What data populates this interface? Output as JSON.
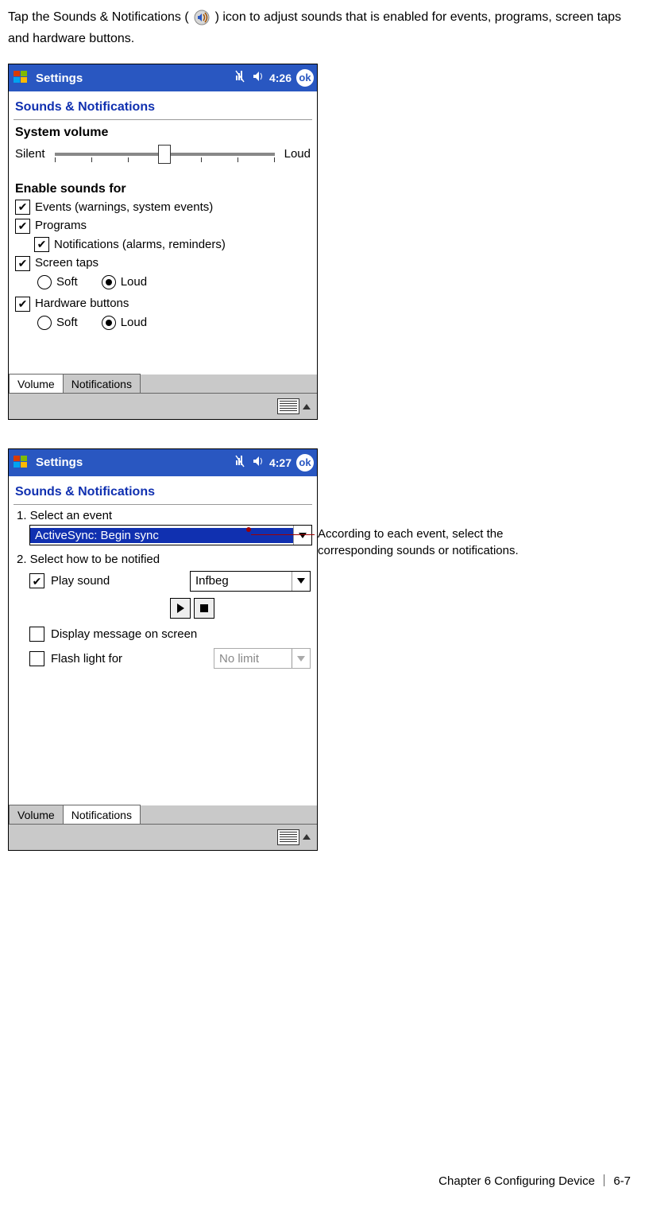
{
  "intro_before": "Tap the Sounds & Notifications (",
  "intro_after": ") icon to adjust sounds that is enabled for events, programs, screen taps and hardware buttons.",
  "screen1": {
    "title": "Settings",
    "time": "4:26",
    "ok": "ok",
    "panel": "Sounds & Notifications",
    "sysvol": "System volume",
    "silent": "Silent",
    "loud": "Loud",
    "enable": "Enable sounds for",
    "events": "Events (warnings, system events)",
    "programs": "Programs",
    "notifications": "Notifications (alarms, reminders)",
    "screentaps": "Screen taps",
    "soft1": "Soft",
    "loud1": "Loud",
    "hwbtn": "Hardware buttons",
    "soft2": "Soft",
    "loud2": "Loud",
    "tab_volume": "Volume",
    "tab_notif": "Notifications"
  },
  "screen2": {
    "title": "Settings",
    "time": "4:27",
    "ok": "ok",
    "panel": "Sounds & Notifications",
    "step1": "1. Select an event",
    "event_sel": "ActiveSync: Begin sync",
    "step2": "2. Select how to be notified",
    "play": "Play sound",
    "sound_sel": "Infbeg",
    "display_msg": "Display message on screen",
    "flash": "Flash light for",
    "flash_sel": "No limit",
    "tab_volume": "Volume",
    "tab_notif": "Notifications"
  },
  "callout": "According to each event, select the corresponding sounds or notifications.",
  "footer_chapter": "Chapter 6    Configuring Device",
  "footer_sep": "｜",
  "footer_page": "6-7"
}
